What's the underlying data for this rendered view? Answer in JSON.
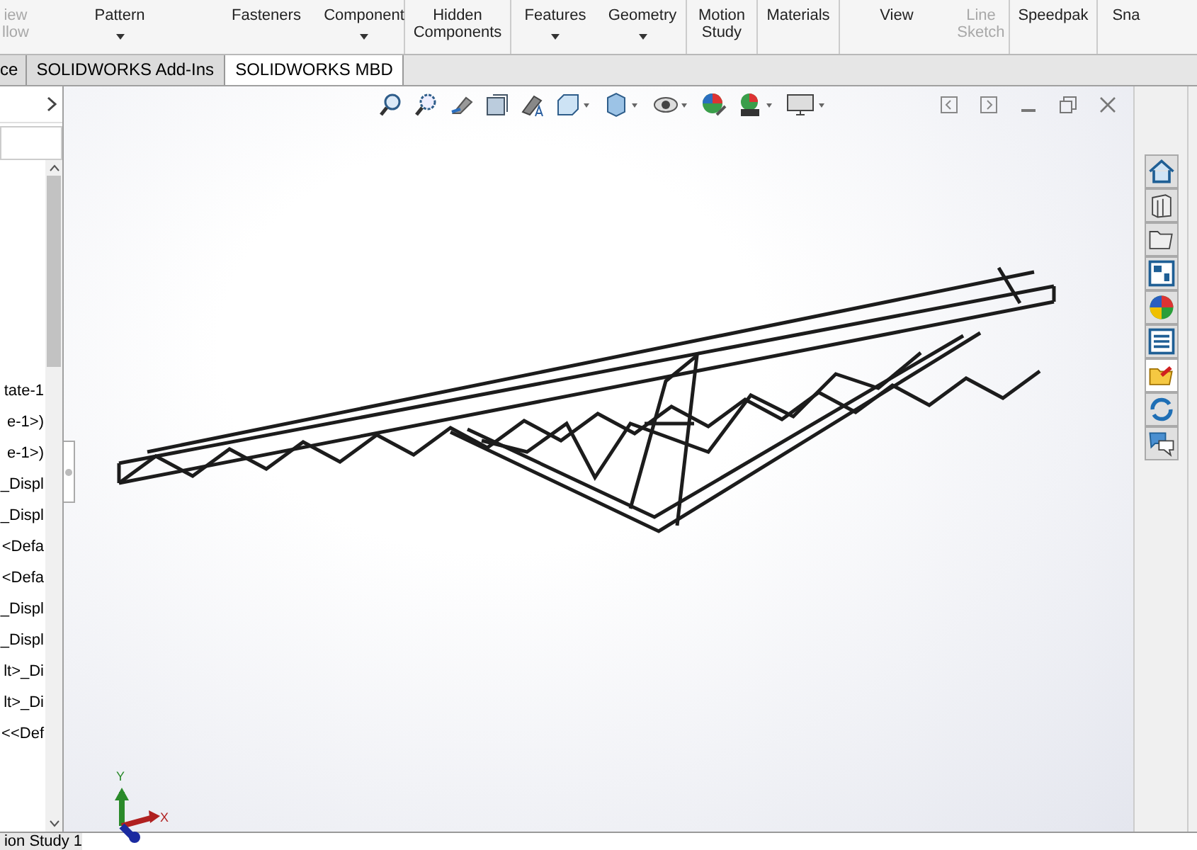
{
  "ribbon": [
    {
      "lines": [
        "iew",
        "llow"
      ],
      "disabled": true,
      "caret": false,
      "sep": false
    },
    {
      "lines": [
        "Pattern"
      ],
      "disabled": false,
      "caret": true,
      "sep": false
    },
    {
      "lines": [
        "Fasteners"
      ],
      "disabled": false,
      "caret": false,
      "sep": false
    },
    {
      "lines": [
        "Component"
      ],
      "disabled": false,
      "caret": true,
      "sep": true
    },
    {
      "lines": [
        "Hidden",
        "Components"
      ],
      "disabled": false,
      "caret": false,
      "sep": true
    },
    {
      "lines": [
        "Features"
      ],
      "disabled": false,
      "caret": true,
      "sep": false
    },
    {
      "lines": [
        "Geometry"
      ],
      "disabled": false,
      "caret": true,
      "sep": true
    },
    {
      "lines": [
        "Motion",
        "Study"
      ],
      "disabled": false,
      "caret": false,
      "sep": true
    },
    {
      "lines": [
        "Materials"
      ],
      "disabled": false,
      "caret": false,
      "sep": true
    },
    {
      "lines": [
        "View"
      ],
      "disabled": false,
      "caret": false,
      "sep": false
    },
    {
      "lines": [
        "Line",
        "Sketch"
      ],
      "disabled": true,
      "caret": false,
      "sep": true
    },
    {
      "lines": [
        "Speedpak"
      ],
      "disabled": false,
      "caret": false,
      "sep": true
    },
    {
      "lines": [
        "Sna"
      ],
      "disabled": false,
      "caret": false,
      "sep": false
    }
  ],
  "tabs": [
    {
      "label": "ce",
      "selected": false
    },
    {
      "label": "SOLIDWORKS Add-Ins",
      "selected": false
    },
    {
      "label": "SOLIDWORKS MBD",
      "selected": true
    }
  ],
  "tree": {
    "items": [
      "tate-1",
      "e-1>)",
      "e-1>)",
      "_Displ",
      "_Displ",
      "<Defa",
      "<Defa",
      "_Displ",
      "_Displ",
      "lt>_Di",
      "lt>_Di",
      "<<Def"
    ]
  },
  "axes": {
    "y": "Y",
    "x": "X"
  },
  "status_tab": "ion Study 1"
}
